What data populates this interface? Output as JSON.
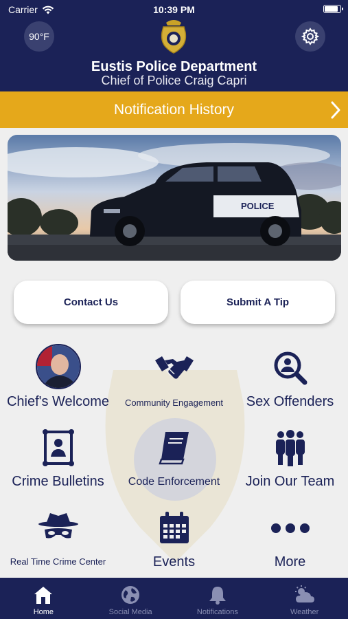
{
  "status_bar": {
    "carrier": "Carrier",
    "time": "10:39 PM",
    "battery_level": 0.9
  },
  "header": {
    "temperature": "90°F",
    "title": "Eustis Police Department",
    "subtitle": "Chief of Police Craig Capri"
  },
  "notification_bar": {
    "label": "Notification History"
  },
  "actions": {
    "contact_label": "Contact Us",
    "tip_label": "Submit A Tip"
  },
  "grid": [
    {
      "label": "Chief's Welcome",
      "icon": "chief-avatar"
    },
    {
      "label": "Community Engagement",
      "icon": "handshake-icon"
    },
    {
      "label": "Sex Offenders",
      "icon": "user-search-icon"
    },
    {
      "label": "Crime Bulletins",
      "icon": "portrait-frame-icon"
    },
    {
      "label": "Code Enforcement",
      "icon": "book-icon"
    },
    {
      "label": "Join Our Team",
      "icon": "group-icon"
    },
    {
      "label": "Real Time Crime Center",
      "icon": "spy-icon"
    },
    {
      "label": "Events",
      "icon": "calendar-icon"
    },
    {
      "label": "More",
      "icon": "more-dots-icon"
    }
  ],
  "tabs": [
    {
      "label": "Home",
      "icon": "home-icon",
      "active": true
    },
    {
      "label": "Social Media",
      "icon": "globe-icon",
      "active": false
    },
    {
      "label": "Notifications",
      "icon": "bell-icon",
      "active": false
    },
    {
      "label": "Weather",
      "icon": "weather-icon",
      "active": false
    }
  ],
  "colors": {
    "navy": "#1b2257",
    "gold": "#e5a81b",
    "background": "#efefef"
  }
}
